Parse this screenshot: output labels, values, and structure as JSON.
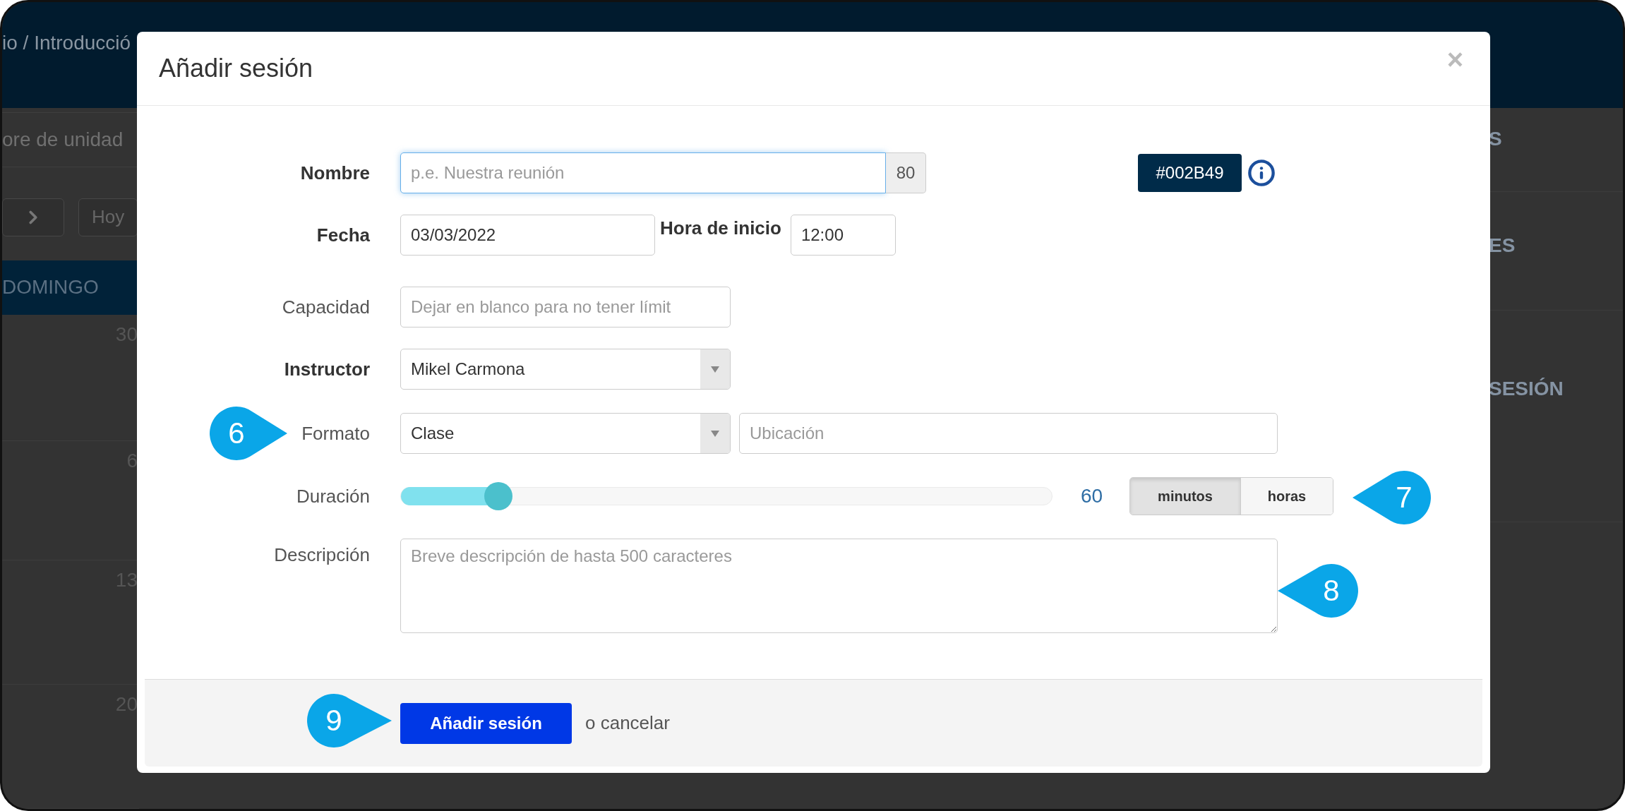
{
  "background": {
    "breadcrumb": "io / Introducció",
    "unit_field": "ore de unidad",
    "today_button": "Hoy",
    "day_header": "DOMINGO",
    "day_numbers": [
      "30",
      "6",
      "13",
      "20"
    ],
    "side_items": [
      "S",
      "ES",
      "SESIÓN"
    ]
  },
  "dialog": {
    "title": "Añadir sesión",
    "close": "×",
    "name": {
      "label": "Nombre",
      "emphasized": true,
      "placeholder": "p.e. Nuestra reunión",
      "focused": true,
      "counter": "80"
    },
    "color_picker": {
      "value": "#002B49",
      "color": "#002b49"
    },
    "date": {
      "label": "Fecha",
      "emphasized": true,
      "value": "03/03/2022"
    },
    "start_time": {
      "label": "Hora de inicio",
      "value": "12:00"
    },
    "capacity": {
      "label": "Capacidad",
      "emphasized": false,
      "placeholder": "Dejar en blanco para no tener límit"
    },
    "instructor": {
      "label": "Instructor",
      "emphasized": true,
      "value": "Mikel Carmona"
    },
    "format": {
      "label": "Formato",
      "emphasized": false,
      "value": "Clase",
      "location_placeholder": "Ubicación",
      "callout": "6"
    },
    "duration": {
      "label": "Duración",
      "emphasized": false,
      "level": 0.15,
      "reading": "60",
      "callout": "7",
      "units": [
        {
          "label": "minutos",
          "selected": true
        },
        {
          "label": "horas",
          "selected": false
        }
      ]
    },
    "description": {
      "label": "Descripción",
      "emphasized": false,
      "placeholder": "Breve descripción de hasta 500 caracteres",
      "callout": "8"
    },
    "footer": {
      "submit_button": "Añadir sesión",
      "cancel_text": "o cancelar",
      "callout": "9"
    }
  }
}
